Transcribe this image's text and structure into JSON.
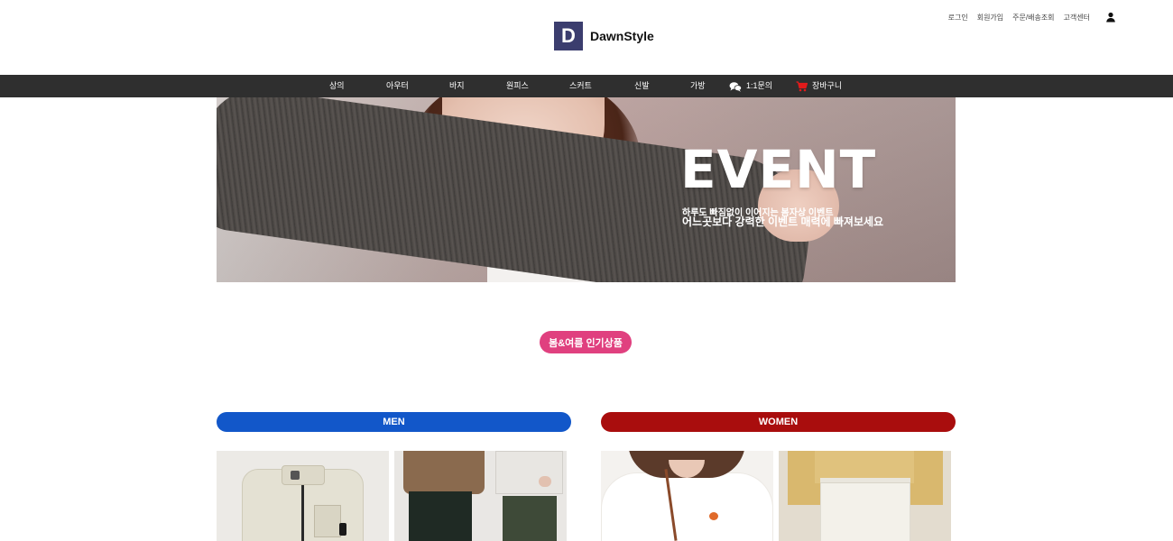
{
  "util_links": [
    "로그인",
    "회원가입",
    "주문/배송조회",
    "고객센터"
  ],
  "logo": {
    "mark": "D",
    "text": "DawnStyle"
  },
  "nav": {
    "items": [
      "상의",
      "아우터",
      "바지",
      "원피스",
      "스커트",
      "신발",
      "가방"
    ],
    "inquiry": "1:1문의",
    "cart": "장바구니"
  },
  "banner": {
    "title": "EVENT",
    "sub1": "하루도 빠짐없이 이어지는 봄자상 이벤트",
    "sub2": "어느곳보다 강력한 이벤트 매력에 빠져보세요"
  },
  "popular_label": "봄&여름 인기상품",
  "categories": {
    "men": "MEN",
    "women": "WOMEN"
  },
  "colors": {
    "nav_bg": "#2f2f2f",
    "logo_bg": "#3b3d6e",
    "pill": "#e0407f",
    "men": "#1257c9",
    "women": "#a90d0d",
    "cart_icon": "#e21b1b"
  }
}
